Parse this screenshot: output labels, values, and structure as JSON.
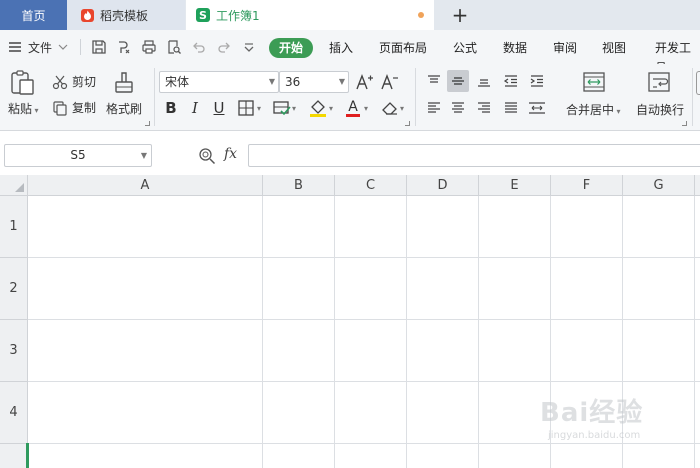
{
  "tabs": {
    "home": "首页",
    "docer": "稻壳模板",
    "workbook": "工作簿1",
    "new_tab": "+"
  },
  "menu": {
    "file": "文件",
    "tabs": [
      "开始",
      "插入",
      "页面布局",
      "公式",
      "数据",
      "审阅",
      "视图",
      "开发工具"
    ],
    "active_tab": "开始"
  },
  "ribbon": {
    "paste": "粘贴",
    "cut": "剪切",
    "copy": "复制",
    "format_painter": "格式刷",
    "font_name": "宋体",
    "font_size": "36",
    "bold": "B",
    "italic": "I",
    "underline": "U",
    "font_color_letter": "A",
    "merge_center": "合并居中",
    "wrap_text": "自动换行"
  },
  "formula_bar": {
    "name_box": "S5",
    "fx_label": "fx",
    "formula_value": ""
  },
  "grid": {
    "columns": [
      "A",
      "B",
      "C",
      "D",
      "E",
      "F",
      "G"
    ],
    "rows": [
      "1",
      "2",
      "3",
      "4"
    ]
  },
  "watermark": {
    "brand": "Bai经验",
    "url": "jingyan.baidu.com"
  },
  "colors": {
    "home_tab": "#4b72b4",
    "accent_green": "#3c9c55",
    "docer_red": "#e9462d",
    "unsaved_dot": "#f0a35a"
  }
}
